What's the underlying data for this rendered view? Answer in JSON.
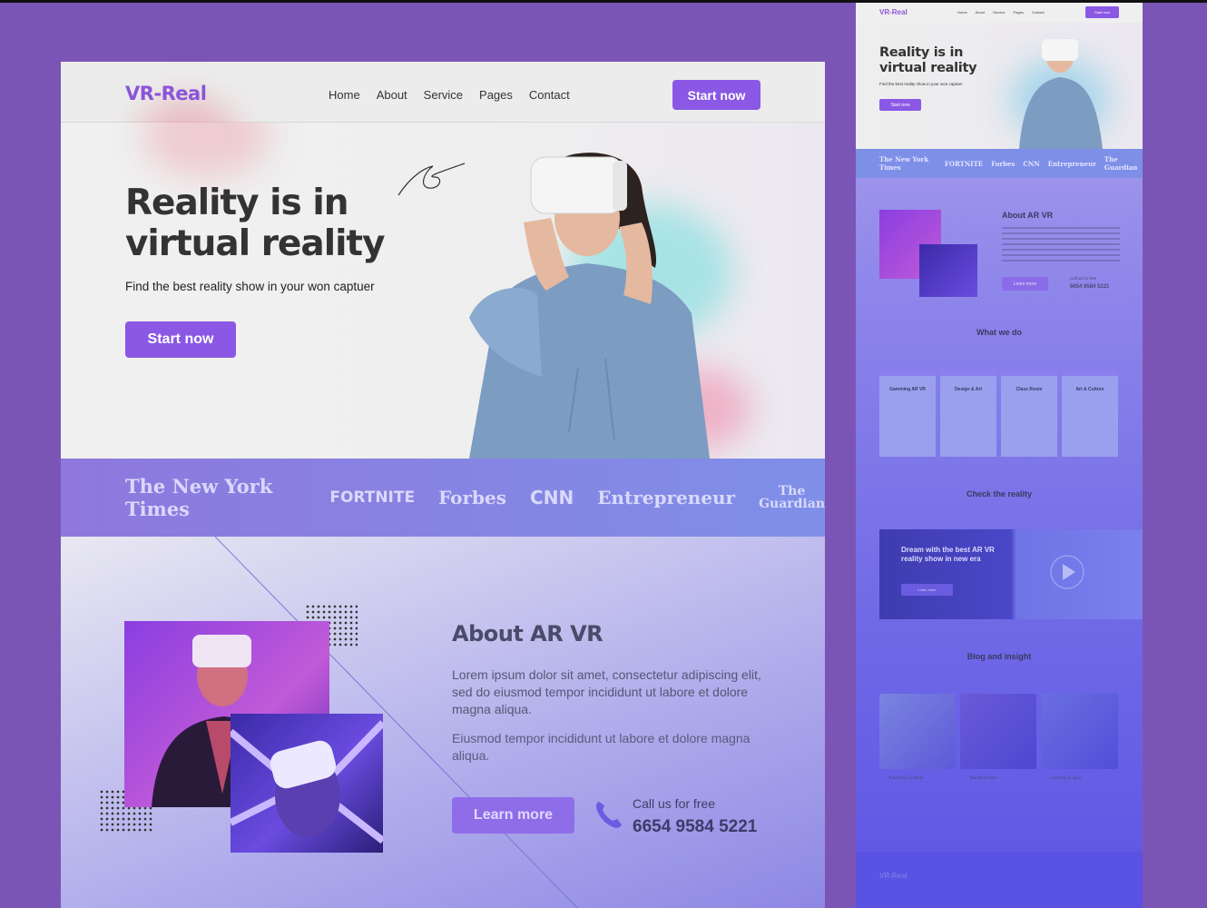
{
  "main": {
    "logo": "VR-Real",
    "nav": [
      "Home",
      "About",
      "Service",
      "Pages",
      "Contact"
    ],
    "header_button": "Start now",
    "hero": {
      "title": "Reality is in virtual reality",
      "subtitle": "Find the best reality show in your won captuer",
      "button": "Start now"
    },
    "logos": [
      "The New York Times",
      "FORTNITE",
      "Forbes",
      "CNN",
      "Entrepreneur",
      "The Guardian"
    ],
    "about": {
      "title": "About AR VR",
      "paragraph1": "Lorem ipsum dolor sit amet, consectetur adipiscing elit, sed do eiusmod tempor incididunt ut labore et dolore magna aliqua.",
      "paragraph2": "Eiusmod tempor incididunt ut labore et dolore magna aliqua.",
      "button": "Learn more",
      "call_label": "Call us for free",
      "call_number": "6654 9584 5221"
    }
  },
  "side": {
    "logo": "VR-Real",
    "nav": [
      "Home",
      "About",
      "Service",
      "Pages",
      "Contact"
    ],
    "header_button": "Start now",
    "hero_title": "Reality is in virtual reality",
    "hero_subtitle": "Find the best reality show in your won captuer",
    "hero_button": "Start now",
    "logos": [
      "The New York Times",
      "FORTNITE",
      "Forbes",
      "CNN",
      "Entrepreneur",
      "The Guardian"
    ],
    "about_title": "About AR VR",
    "call_label": "Call us for free",
    "call_number": "6654 9584 5221",
    "learn_more": "Learn more",
    "what_we_do": "What we do",
    "cards": [
      "Gamming AR VR",
      "Design & Art",
      "Class Room",
      "Art & Culture"
    ],
    "card_link": "Learn more",
    "check_title": "Check the reality",
    "video_text": "Dream with the best AR VR reality show in new era",
    "video_button": "Learn more",
    "blog_title": "Blog and insight",
    "blogs": [
      "Teaching is a talent",
      "Talents to learn",
      "Learning is open"
    ],
    "footer_logo": "VR-Real"
  },
  "colors": {
    "accent": "#8a58e4",
    "background": "#7b55b5"
  }
}
